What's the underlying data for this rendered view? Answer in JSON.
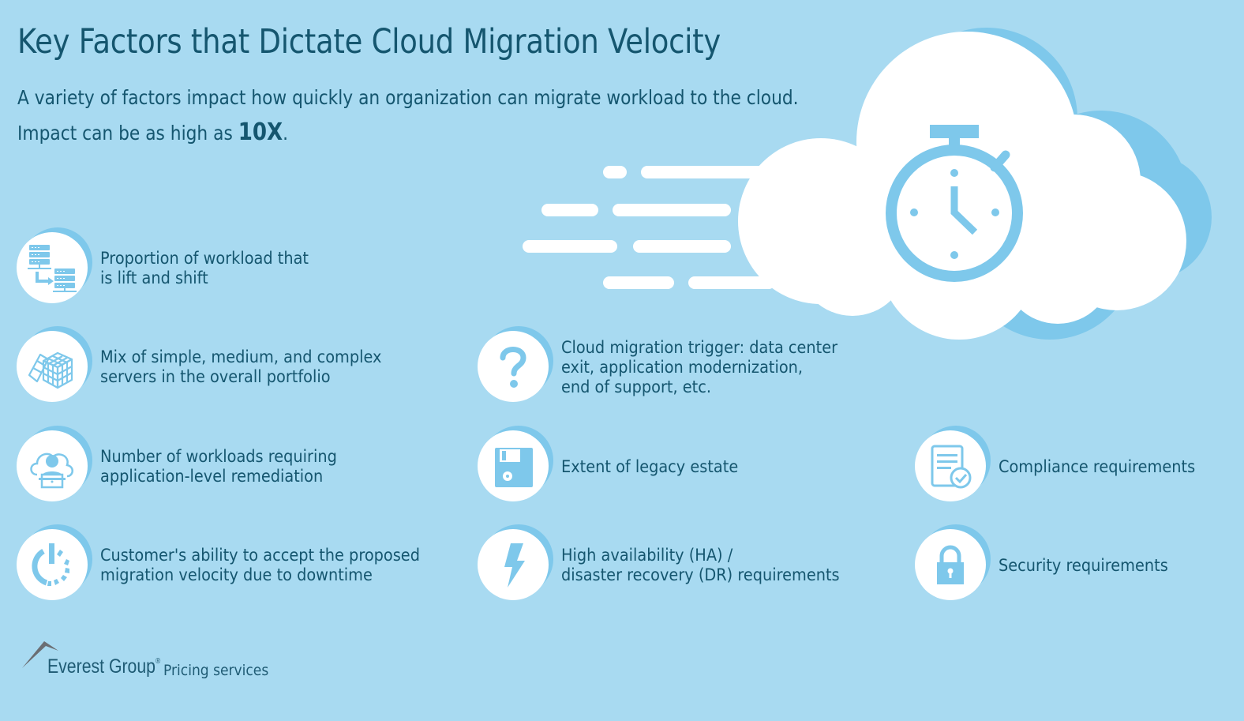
{
  "header": {
    "title": "Key Factors that Dictate Cloud Migration Velocity",
    "subtitle_line1": "A variety of factors impact how quickly an organization can migrate workload to the cloud.",
    "subtitle_line2_prefix": "Impact can be as high as ",
    "subtitle_highlight": "10X",
    "subtitle_line2_suffix": "."
  },
  "hero": {
    "icon": "stopwatch-in-cloud-icon",
    "colors": {
      "cloud": "#ffffff",
      "cloud_shadow": "#7ec8eb",
      "stopwatch": "#7ec8eb"
    }
  },
  "factors": [
    {
      "icon": "server-migration-icon",
      "text": "Proportion of workload that\nis lift and shift"
    },
    {
      "icon": "cube-puzzle-icon",
      "text": "Mix of simple, medium, and complex\nservers in the overall portfolio"
    },
    {
      "icon": "user-cloud-laptop-icon",
      "text": "Number of workloads requiring\napplication-level remediation"
    },
    {
      "icon": "power-loading-icon",
      "text": "Customer's ability to accept the proposed\nmigration velocity due to downtime"
    },
    {
      "icon": "question-mark-icon",
      "text": "Cloud migration trigger: data center\nexit, application modernization,\nend of support, etc."
    },
    {
      "icon": "floppy-disk-icon",
      "text": "Extent of legacy estate"
    },
    {
      "icon": "lightning-bolt-icon",
      "text": "High availability (HA) /\ndisaster recovery (DR) requirements"
    },
    {
      "icon": "compliance-document-icon",
      "text": "Compliance requirements"
    },
    {
      "icon": "padlock-icon",
      "text": "Security requirements"
    }
  ],
  "footer": {
    "brand": "Everest Group",
    "registered": "®",
    "tagline": "Pricing services"
  },
  "colors": {
    "background": "#a8daf1",
    "text": "#15566f",
    "icon": "#7ec8eb",
    "disc": "#ffffff"
  }
}
